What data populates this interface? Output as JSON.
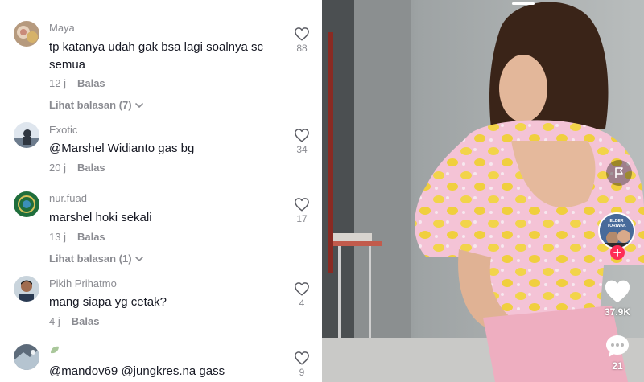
{
  "comments": [
    {
      "username": "Maya",
      "text": "tp katanya udah gak bsa lagi soalnya sc semua",
      "time": "12 j",
      "reply_label": "Balas",
      "likes": "88",
      "view_replies": "Lihat balasan (7)"
    },
    {
      "username": "Exotic",
      "mention": "@Marshel Widianto",
      "text": " gas bg",
      "time": "20 j",
      "reply_label": "Balas",
      "likes": "34"
    },
    {
      "username": "nur.fuad",
      "text": "marshel hoki sekali",
      "time": "13 j",
      "reply_label": "Balas",
      "likes": "17",
      "view_replies": "Lihat balasan (1)"
    },
    {
      "username": "Pikih Prihatmo",
      "text": "mang siapa yg cetak?",
      "time": "4 j",
      "reply_label": "Balas",
      "likes": "4"
    },
    {
      "username": "",
      "text": "@mandov69 @jungkres.na gass",
      "likes": "9"
    }
  ],
  "video": {
    "like_count": "37.9K",
    "comment_count": "21",
    "avatar_caption_line1": "ELDER",
    "avatar_caption_line2": "TORIWAK"
  },
  "colors": {
    "like_count_text": "#ffffff",
    "follow_badge": "#fe2c55",
    "muted_text": "#8a8b91"
  },
  "icons": {
    "comment_like": "heart-outline-icon",
    "report": "flag-icon",
    "video_like": "heart-filled-icon",
    "video_comment": "comment-bubble-icon",
    "follow": "plus-icon",
    "expand": "chevron-down-icon"
  }
}
